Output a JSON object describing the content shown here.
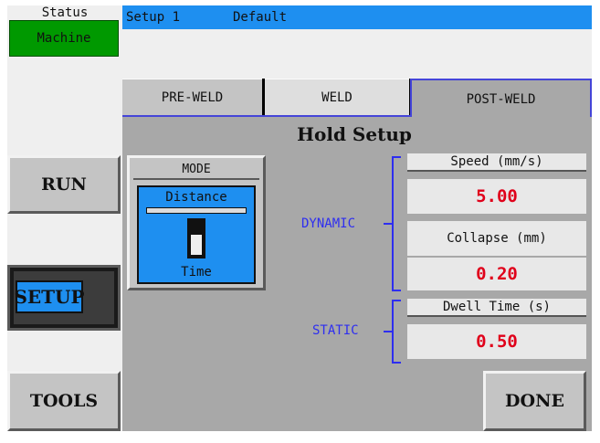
{
  "status": {
    "label": "Status",
    "machine": "Machine"
  },
  "title_bar": {
    "setup": "Setup 1",
    "preset": "Default"
  },
  "tabs": [
    {
      "label": "PRE-WELD",
      "active": false
    },
    {
      "label": "WELD",
      "active": false
    },
    {
      "label": "POST-WELD",
      "active": true
    }
  ],
  "panel_title": "Hold Setup",
  "nav": {
    "run": "RUN",
    "setup": "SETUP",
    "tools": "TOOLS"
  },
  "mode": {
    "title": "MODE",
    "option_top": "Distance",
    "option_bottom": "Time",
    "selected": "Time"
  },
  "groups": {
    "dynamic": "DYNAMIC",
    "static": "STATIC"
  },
  "fields": {
    "speed": {
      "label": "Speed (mm/s)",
      "value": "5.00"
    },
    "collapse": {
      "label": "Collapse (mm)",
      "value": "0.20"
    },
    "dwell": {
      "label": "Dwell Time (s)",
      "value": "0.50"
    }
  },
  "done": "DONE",
  "colors": {
    "accent_blue": "#1e8ff0",
    "machine_green": "#009900",
    "value_red": "#e0001a",
    "label_blue": "#2e2ef0",
    "panel_gray": "#a8a8a8"
  }
}
